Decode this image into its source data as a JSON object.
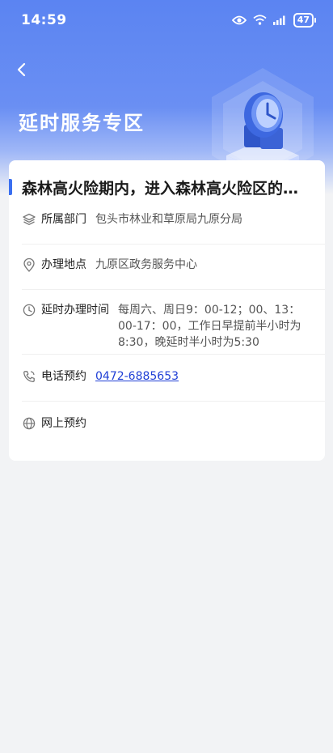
{
  "status_bar": {
    "time": "14:59",
    "battery": "47",
    "icons": [
      "eye-icon",
      "wifi-icon",
      "signal-icon",
      "battery-icon"
    ]
  },
  "header": {
    "title": "延时服务专区"
  },
  "card": {
    "title": "森林高火险期内，进入森林高火险区的审批",
    "rows": [
      {
        "icon": "layers-icon",
        "label": "所属部门",
        "value": "包头市林业和草原局九原分局"
      },
      {
        "icon": "location-pin-icon",
        "label": "办理地点",
        "value": "九原区政务服务中心"
      },
      {
        "icon": "clock-icon",
        "label": "延时办理时间",
        "value": "每周六、周日9：00-12；00、13：00-17：00，工作日早提前半小时为8:30，晚延时半小时为5:30"
      },
      {
        "icon": "phone-icon",
        "label": "电话预约",
        "value": "0472-6885653"
      },
      {
        "icon": "globe-icon",
        "label": "网上预约",
        "value": ""
      }
    ]
  },
  "colors": {
    "header_gradient_top": "#5b84f2",
    "accent": "#3a6ff0",
    "link": "#1f3fd6",
    "background": "#f2f3f5"
  }
}
